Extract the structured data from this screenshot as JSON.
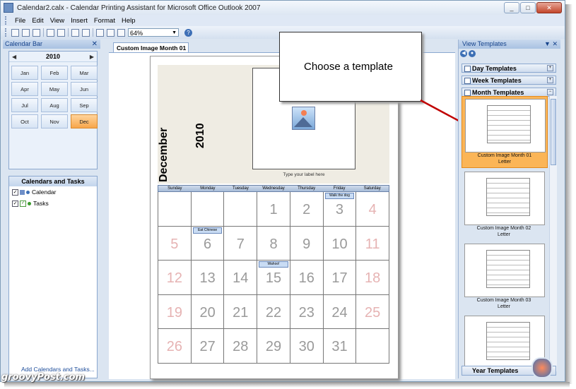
{
  "window": {
    "title": "Calendar2.calx - Calendar Printing Assistant for Microsoft Office Outlook 2007",
    "controls": [
      "_",
      "□",
      "✕"
    ]
  },
  "menu": [
    "File",
    "Edit",
    "View",
    "Insert",
    "Format",
    "Help"
  ],
  "toolbar": {
    "zoom": "64%"
  },
  "left_pane": {
    "title": "Calendar Bar",
    "year": "2010",
    "months": [
      "Jan",
      "Feb",
      "Mar",
      "Apr",
      "May",
      "Jun",
      "Jul",
      "Aug",
      "Sep",
      "Oct",
      "Nov",
      "Dec"
    ],
    "selected_month": "Dec",
    "cal_tasks_title": "Calendars and Tasks",
    "items": [
      {
        "label": "Calendar",
        "checked": "✓",
        "color": "#3d6fb6"
      },
      {
        "label": "Tasks",
        "checked": "✓",
        "color": "#3a9a2c"
      }
    ],
    "add_link": "Add Calendars and Tasks..."
  },
  "tab": {
    "label": "Custom Image Month 01"
  },
  "calendar_page": {
    "month": "December",
    "year": "2010",
    "image_caption": "Type your label here",
    "days_of_week": [
      "Sunday",
      "Monday",
      "Tuesday",
      "Wednesday",
      "Thursday",
      "Friday",
      "Saturday"
    ],
    "weeks": [
      [
        "",
        "",
        "",
        "1",
        "2",
        "3",
        "4"
      ],
      [
        "5",
        "6",
        "7",
        "8",
        "9",
        "10",
        "11"
      ],
      [
        "12",
        "13",
        "14",
        "15",
        "16",
        "17",
        "18"
      ],
      [
        "19",
        "20",
        "21",
        "22",
        "23",
        "24",
        "25"
      ],
      [
        "26",
        "27",
        "28",
        "29",
        "30",
        "31",
        ""
      ]
    ],
    "events": [
      {
        "week": 0,
        "day": 5,
        "label": "Walk the dog"
      },
      {
        "week": 1,
        "day": 1,
        "label": "Eat Chinese"
      },
      {
        "week": 2,
        "day": 3,
        "label": "Wahoo!"
      }
    ]
  },
  "callout": {
    "text": "Choose a template"
  },
  "right_pane": {
    "title": "View Templates",
    "sections": {
      "day": "Day Templates",
      "week": "Week Templates",
      "month": "Month Templates",
      "year": "Year Templates"
    },
    "thumbnails": [
      {
        "name": "Custom Image Month 01",
        "size": "Letter",
        "selected": true
      },
      {
        "name": "Custom Image Month 02",
        "size": "Letter",
        "selected": false
      },
      {
        "name": "Custom Image Month 03",
        "size": "Letter",
        "selected": false
      },
      {
        "name": "",
        "size": "",
        "selected": false
      }
    ]
  },
  "watermark": "groovyPost.com"
}
